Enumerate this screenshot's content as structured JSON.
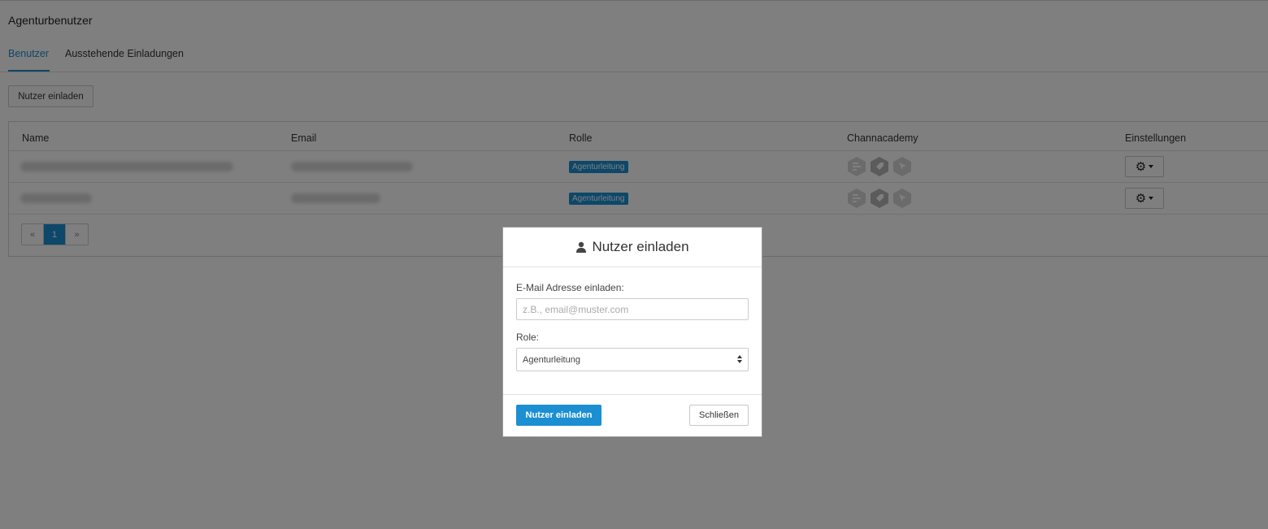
{
  "page": {
    "title": "Agenturbenutzer"
  },
  "tabs": [
    {
      "label": "Benutzer",
      "active": true
    },
    {
      "label": "Ausstehende Einladungen",
      "active": false
    }
  ],
  "toolbar": {
    "invite_label": "Nutzer einladen"
  },
  "table": {
    "columns": [
      "Name",
      "Email",
      "Rolle",
      "Channacademy",
      "Einstellungen"
    ],
    "rows": [
      {
        "role": "Agenturleitung",
        "settings_icon": "gear-icon"
      },
      {
        "role": "Agenturleitung",
        "settings_icon": "gear-icon"
      }
    ],
    "channacademy_icons": [
      "hex-bars-icon",
      "hex-tag-icon",
      "hex-cursor-icon"
    ]
  },
  "pagination": {
    "prev": "«",
    "current": "1",
    "next": "»"
  },
  "modal": {
    "title": "Nutzer einladen",
    "title_icon": "user-icon",
    "email_label": "E-Mail Adresse einladen:",
    "email_placeholder": "z.B., email@muster.com",
    "email_value": "",
    "role_label": "Role:",
    "role_value": "Agenturleitung",
    "submit_label": "Nutzer einladen",
    "close_label": "Schließen"
  },
  "colors": {
    "accent": "#1b8fd2",
    "overlay": "rgba(0,0,0,0.5)"
  }
}
